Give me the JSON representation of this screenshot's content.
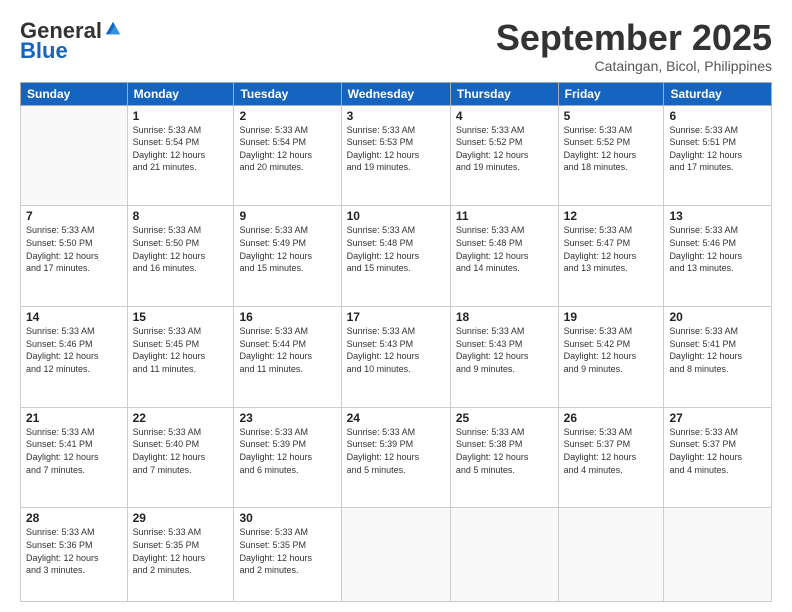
{
  "header": {
    "logo_general": "General",
    "logo_blue": "Blue",
    "month": "September 2025",
    "location": "Cataingan, Bicol, Philippines"
  },
  "weekdays": [
    "Sunday",
    "Monday",
    "Tuesday",
    "Wednesday",
    "Thursday",
    "Friday",
    "Saturday"
  ],
  "weeks": [
    [
      {
        "day": "",
        "info": ""
      },
      {
        "day": "1",
        "info": "Sunrise: 5:33 AM\nSunset: 5:54 PM\nDaylight: 12 hours\nand 21 minutes."
      },
      {
        "day": "2",
        "info": "Sunrise: 5:33 AM\nSunset: 5:54 PM\nDaylight: 12 hours\nand 20 minutes."
      },
      {
        "day": "3",
        "info": "Sunrise: 5:33 AM\nSunset: 5:53 PM\nDaylight: 12 hours\nand 19 minutes."
      },
      {
        "day": "4",
        "info": "Sunrise: 5:33 AM\nSunset: 5:52 PM\nDaylight: 12 hours\nand 19 minutes."
      },
      {
        "day": "5",
        "info": "Sunrise: 5:33 AM\nSunset: 5:52 PM\nDaylight: 12 hours\nand 18 minutes."
      },
      {
        "day": "6",
        "info": "Sunrise: 5:33 AM\nSunset: 5:51 PM\nDaylight: 12 hours\nand 17 minutes."
      }
    ],
    [
      {
        "day": "7",
        "info": "Sunrise: 5:33 AM\nSunset: 5:50 PM\nDaylight: 12 hours\nand 17 minutes."
      },
      {
        "day": "8",
        "info": "Sunrise: 5:33 AM\nSunset: 5:50 PM\nDaylight: 12 hours\nand 16 minutes."
      },
      {
        "day": "9",
        "info": "Sunrise: 5:33 AM\nSunset: 5:49 PM\nDaylight: 12 hours\nand 15 minutes."
      },
      {
        "day": "10",
        "info": "Sunrise: 5:33 AM\nSunset: 5:48 PM\nDaylight: 12 hours\nand 15 minutes."
      },
      {
        "day": "11",
        "info": "Sunrise: 5:33 AM\nSunset: 5:48 PM\nDaylight: 12 hours\nand 14 minutes."
      },
      {
        "day": "12",
        "info": "Sunrise: 5:33 AM\nSunset: 5:47 PM\nDaylight: 12 hours\nand 13 minutes."
      },
      {
        "day": "13",
        "info": "Sunrise: 5:33 AM\nSunset: 5:46 PM\nDaylight: 12 hours\nand 13 minutes."
      }
    ],
    [
      {
        "day": "14",
        "info": "Sunrise: 5:33 AM\nSunset: 5:46 PM\nDaylight: 12 hours\nand 12 minutes."
      },
      {
        "day": "15",
        "info": "Sunrise: 5:33 AM\nSunset: 5:45 PM\nDaylight: 12 hours\nand 11 minutes."
      },
      {
        "day": "16",
        "info": "Sunrise: 5:33 AM\nSunset: 5:44 PM\nDaylight: 12 hours\nand 11 minutes."
      },
      {
        "day": "17",
        "info": "Sunrise: 5:33 AM\nSunset: 5:43 PM\nDaylight: 12 hours\nand 10 minutes."
      },
      {
        "day": "18",
        "info": "Sunrise: 5:33 AM\nSunset: 5:43 PM\nDaylight: 12 hours\nand 9 minutes."
      },
      {
        "day": "19",
        "info": "Sunrise: 5:33 AM\nSunset: 5:42 PM\nDaylight: 12 hours\nand 9 minutes."
      },
      {
        "day": "20",
        "info": "Sunrise: 5:33 AM\nSunset: 5:41 PM\nDaylight: 12 hours\nand 8 minutes."
      }
    ],
    [
      {
        "day": "21",
        "info": "Sunrise: 5:33 AM\nSunset: 5:41 PM\nDaylight: 12 hours\nand 7 minutes."
      },
      {
        "day": "22",
        "info": "Sunrise: 5:33 AM\nSunset: 5:40 PM\nDaylight: 12 hours\nand 7 minutes."
      },
      {
        "day": "23",
        "info": "Sunrise: 5:33 AM\nSunset: 5:39 PM\nDaylight: 12 hours\nand 6 minutes."
      },
      {
        "day": "24",
        "info": "Sunrise: 5:33 AM\nSunset: 5:39 PM\nDaylight: 12 hours\nand 5 minutes."
      },
      {
        "day": "25",
        "info": "Sunrise: 5:33 AM\nSunset: 5:38 PM\nDaylight: 12 hours\nand 5 minutes."
      },
      {
        "day": "26",
        "info": "Sunrise: 5:33 AM\nSunset: 5:37 PM\nDaylight: 12 hours\nand 4 minutes."
      },
      {
        "day": "27",
        "info": "Sunrise: 5:33 AM\nSunset: 5:37 PM\nDaylight: 12 hours\nand 4 minutes."
      }
    ],
    [
      {
        "day": "28",
        "info": "Sunrise: 5:33 AM\nSunset: 5:36 PM\nDaylight: 12 hours\nand 3 minutes."
      },
      {
        "day": "29",
        "info": "Sunrise: 5:33 AM\nSunset: 5:35 PM\nDaylight: 12 hours\nand 2 minutes."
      },
      {
        "day": "30",
        "info": "Sunrise: 5:33 AM\nSunset: 5:35 PM\nDaylight: 12 hours\nand 2 minutes."
      },
      {
        "day": "",
        "info": ""
      },
      {
        "day": "",
        "info": ""
      },
      {
        "day": "",
        "info": ""
      },
      {
        "day": "",
        "info": ""
      }
    ]
  ]
}
